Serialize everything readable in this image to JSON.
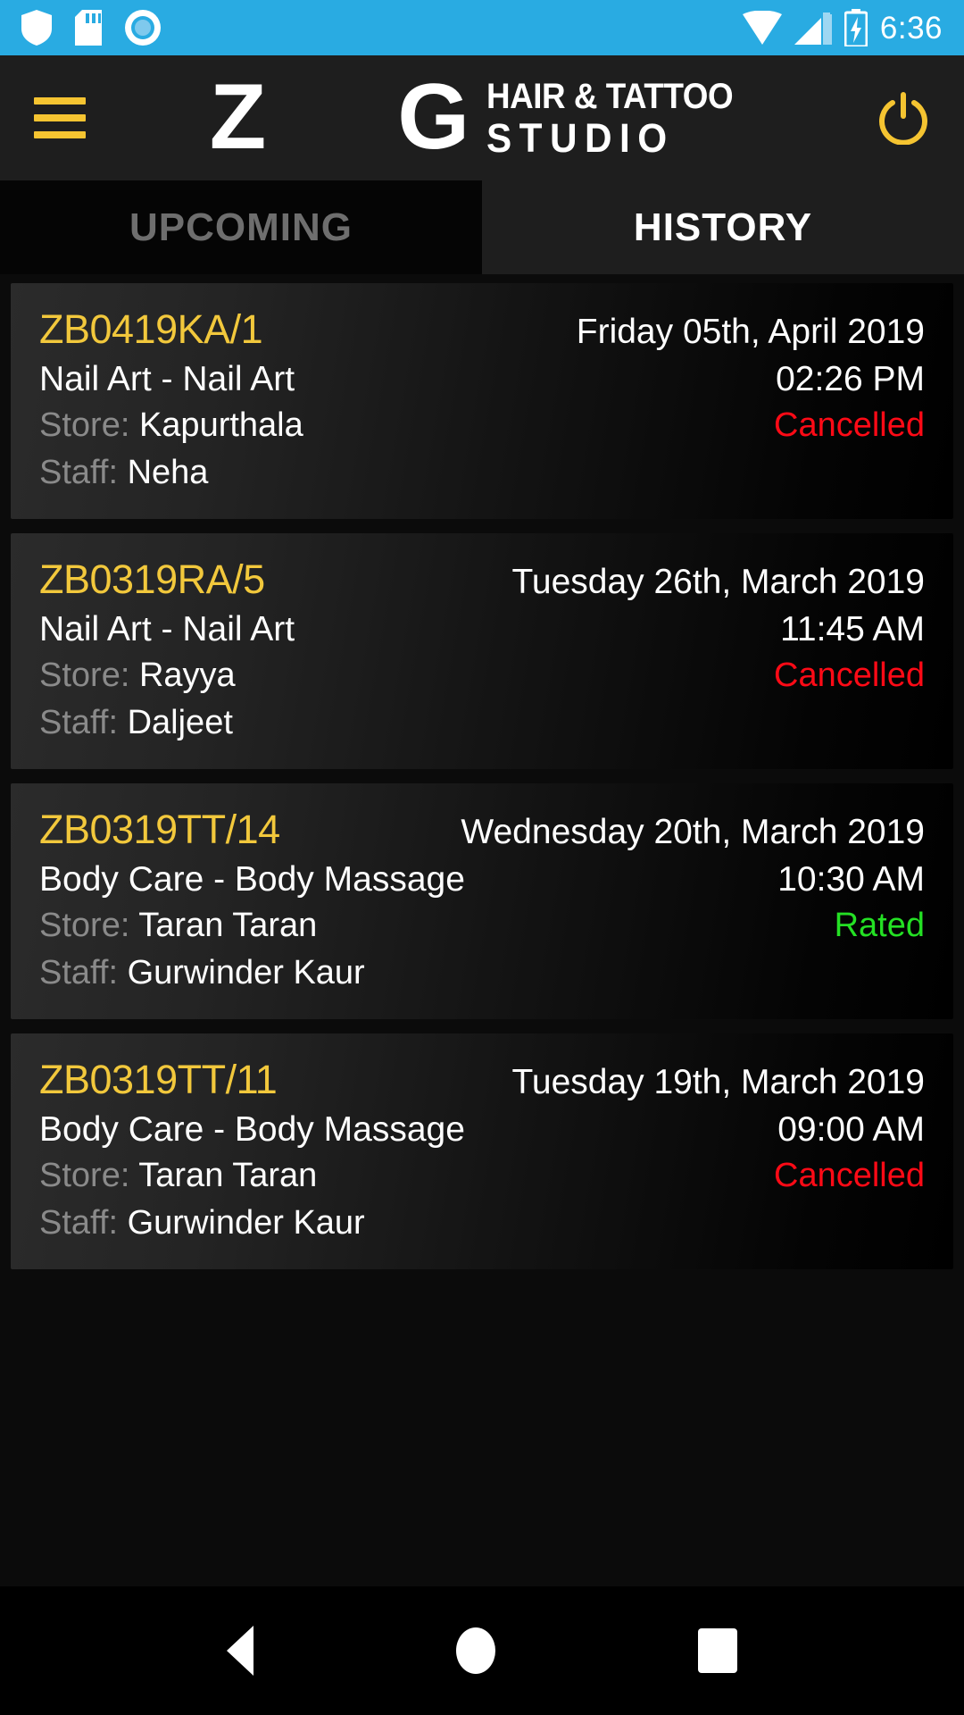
{
  "statusbar": {
    "time": "6:36",
    "left_icons": [
      "shield-icon",
      "sd-card-icon",
      "circle-record-icon"
    ],
    "right_icons": [
      "wifi-icon",
      "cellular-signal-icon",
      "battery-charging-icon"
    ],
    "background": "#29ABE2"
  },
  "header": {
    "menu_icon": "hamburger-menu-icon",
    "power_icon": "power-icon",
    "logo": {
      "z": "Z",
      "g": "G",
      "line1": "HAIR & TATTOO",
      "line2": "STUDIO",
      "ring_colors": [
        "#F5A623",
        "#FFC928"
      ]
    },
    "accent_color": "#F5C431"
  },
  "tabs": [
    {
      "label": "UPCOMING",
      "active": false
    },
    {
      "label": "HISTORY",
      "active": true
    }
  ],
  "labels": {
    "store": "Store:",
    "staff": "Staff:"
  },
  "colors": {
    "code": "#F2C83C",
    "cancelled": "#FF0A16",
    "rated": "#24E024"
  },
  "appointments": [
    {
      "code": "ZB0419KA/1",
      "date": "Friday 05th, April 2019",
      "service": "Nail Art - Nail Art",
      "time": "02:26 PM",
      "store": "Kapurthala",
      "staff": "Neha",
      "status": "Cancelled",
      "status_type": "cancelled"
    },
    {
      "code": "ZB0319RA/5",
      "date": "Tuesday 26th, March 2019",
      "service": "Nail Art - Nail Art",
      "time": "11:45 AM",
      "store": "Rayya",
      "staff": "Daljeet",
      "status": "Cancelled",
      "status_type": "cancelled"
    },
    {
      "code": "ZB0319TT/14",
      "date": "Wednesday 20th, March 2019",
      "service": "Body Care - Body Massage",
      "time": "10:30 AM",
      "store": "Taran Taran",
      "staff": "Gurwinder Kaur",
      "status": "Rated",
      "status_type": "rated"
    },
    {
      "code": "ZB0319TT/11",
      "date": "Tuesday 19th, March 2019",
      "service": "Body Care - Body Massage",
      "time": "09:00 AM",
      "store": "Taran Taran",
      "staff": "Gurwinder Kaur",
      "status": "Cancelled",
      "status_type": "cancelled"
    }
  ],
  "navbar": {
    "back": "back-icon",
    "home": "home-icon",
    "recents": "recents-icon"
  }
}
